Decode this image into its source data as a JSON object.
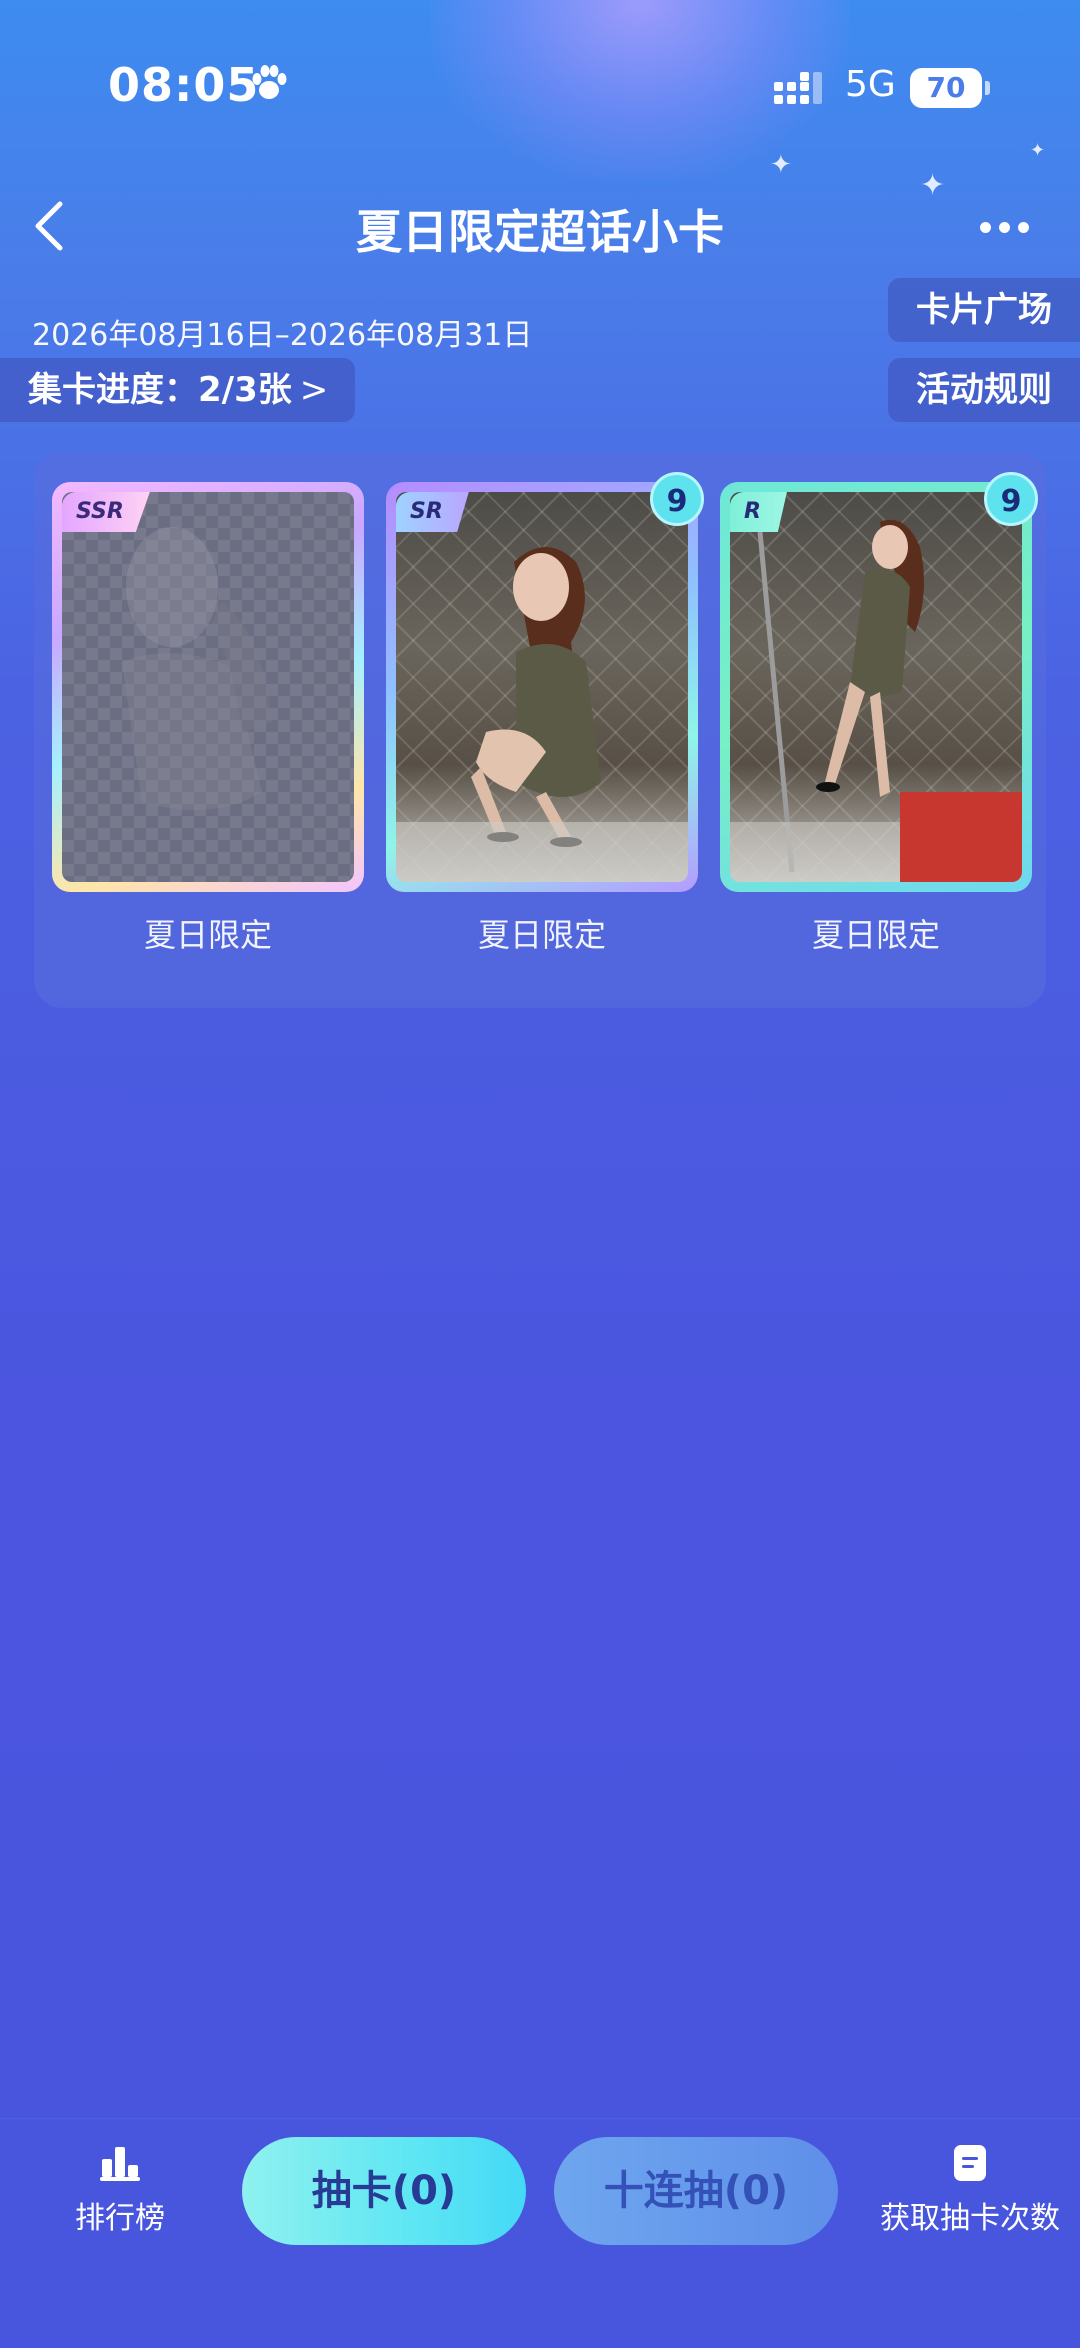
{
  "status_bar": {
    "time": "08:05",
    "network": "5G",
    "battery": "70"
  },
  "header": {
    "title": "夏日限定超话小卡",
    "date_range": "2026年08月16日–2026年08月31日",
    "progress": "集卡进度：2/3张",
    "progress_chevron": ">",
    "card_square_button": "卡片广场",
    "rules_button": "活动规则"
  },
  "cards": [
    {
      "rarity": "SSR",
      "label": "夏日限定",
      "count": "",
      "collected": false
    },
    {
      "rarity": "SR",
      "label": "夏日限定",
      "count": "9",
      "collected": true
    },
    {
      "rarity": "R",
      "label": "夏日限定",
      "count": "9",
      "collected": true
    }
  ],
  "bottom_bar": {
    "ranking_label": "排行榜",
    "draw_label": "抽卡(0)",
    "draw_ten_label": "十连抽(0)",
    "get_draws_label": "获取抽卡次数"
  },
  "colors": {
    "accent_cyan": "#5ee6f3",
    "background_top": "#3d8cf0",
    "background_bottom": "#4a55de"
  }
}
